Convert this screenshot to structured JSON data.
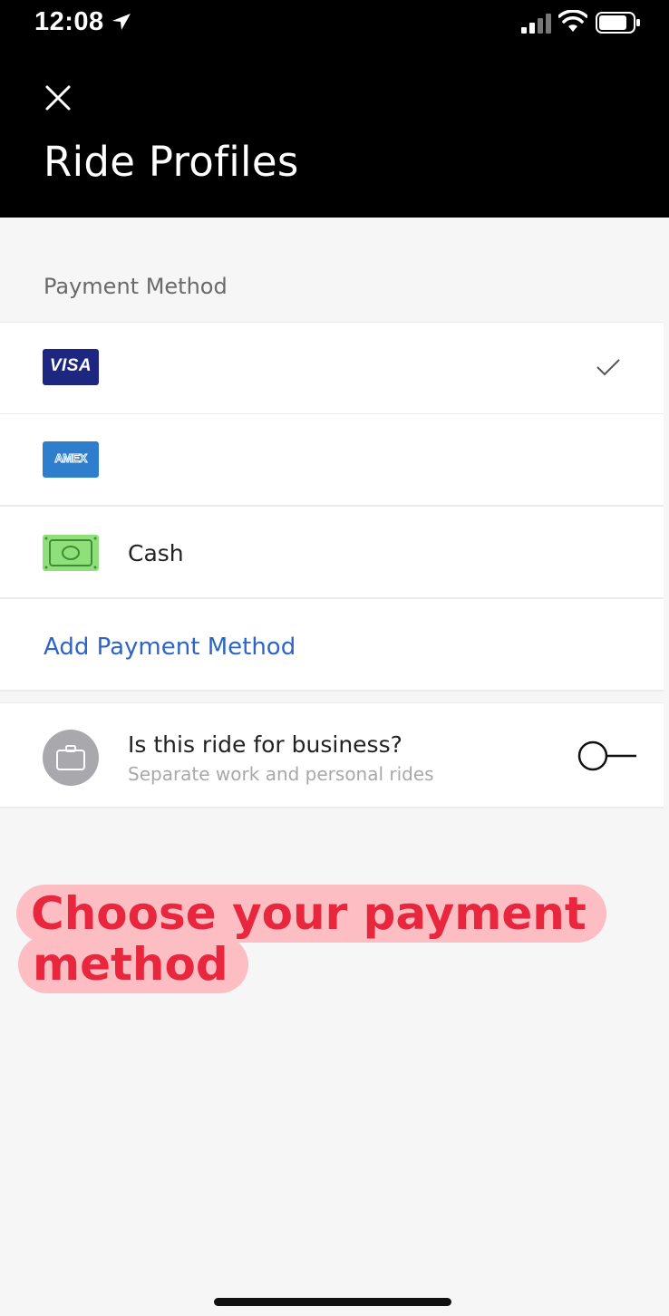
{
  "status_bar": {
    "time": "12:08",
    "icons": [
      "location-arrow-icon",
      "signal-icon",
      "wifi-icon",
      "battery-icon"
    ]
  },
  "header": {
    "title": "Ride Profiles",
    "close_icon": "close-icon"
  },
  "payment": {
    "section_label": "Payment Method",
    "methods": [
      {
        "type": "visa",
        "card_text": "VISA",
        "label": "",
        "selected": true
      },
      {
        "type": "amex",
        "card_text": "AMEX",
        "label": "",
        "selected": false
      },
      {
        "type": "cash",
        "label": "Cash",
        "selected": false
      }
    ],
    "add_label": "Add Payment Method"
  },
  "business": {
    "title": "Is this ride for business?",
    "subtitle": "Separate work and personal rides",
    "enabled": false
  },
  "overlay": {
    "line1": "Choose your payment",
    "line2": "method"
  },
  "colors": {
    "header_bg": "#000000",
    "link": "#2c65c8",
    "visa": "#1d2680",
    "amex": "#2f7ecd",
    "cash": "#8fe07a",
    "overlay_bg": "#fdbec3",
    "overlay_text": "#e8263d"
  }
}
